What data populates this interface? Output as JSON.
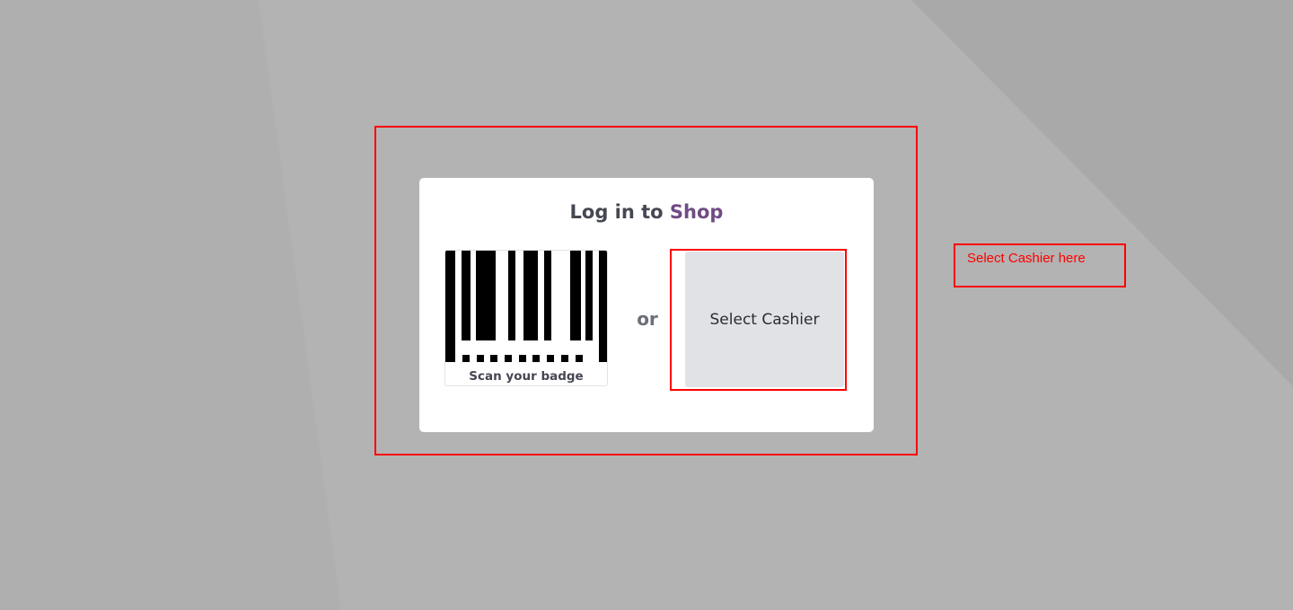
{
  "login": {
    "title_prefix": "Log in to",
    "title_brand": "Shop",
    "badge_label": "Scan your badge",
    "or_label": "or",
    "cashier_button_label": "Select Cashier"
  },
  "annotation": {
    "note": "Select Cashier here"
  },
  "colors": {
    "background": "#b3b3b3",
    "brand": "#714b83",
    "annotation": "#ff0000",
    "button_bg": "#e0e2e6"
  },
  "icons": {
    "badge": "barcode-icon"
  }
}
